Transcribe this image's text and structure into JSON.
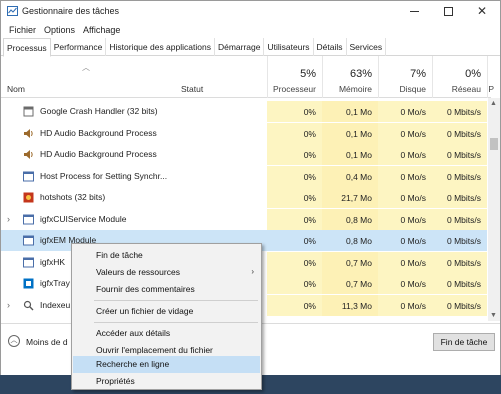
{
  "window": {
    "title": "Gestionnaire des tâches"
  },
  "menubar": [
    "Fichier",
    "Options",
    "Affichage"
  ],
  "tabs": [
    "Processus",
    "Performance",
    "Historique des applications",
    "Démarrage",
    "Utilisateurs",
    "Détails",
    "Services"
  ],
  "header": {
    "name": "Nom",
    "status": "Statut",
    "cpu": {
      "pct": "5%",
      "label": "Processeur"
    },
    "memory": {
      "pct": "63%",
      "label": "Mémoire"
    },
    "disk": {
      "pct": "7%",
      "label": "Disque"
    },
    "network": {
      "pct": "0%",
      "label": "Réseau"
    },
    "extra": {
      "label": "P"
    }
  },
  "rows": [
    {
      "name": "Google Crash Handler (32 bits)",
      "cpu": "0%",
      "mem": "0,1 Mo",
      "disk": "0 Mo/s",
      "net": "0 Mbits/s",
      "icon": "generic-app-icon"
    },
    {
      "name": "HD Audio Background Process",
      "cpu": "0%",
      "mem": "0,1 Mo",
      "disk": "0 Mo/s",
      "net": "0 Mbits/s",
      "icon": "speaker-icon"
    },
    {
      "name": "HD Audio Background Process",
      "cpu": "0%",
      "mem": "0,1 Mo",
      "disk": "0 Mo/s",
      "net": "0 Mbits/s",
      "icon": "speaker-icon"
    },
    {
      "name": "Host Process for Setting Synchr...",
      "cpu": "0%",
      "mem": "0,4 Mo",
      "disk": "0 Mo/s",
      "net": "0 Mbits/s",
      "icon": "window-app-icon"
    },
    {
      "name": "hotshots (32 bits)",
      "cpu": "0%",
      "mem": "21,7 Mo",
      "disk": "0 Mo/s",
      "net": "0 Mbits/s",
      "icon": "hotshots-icon"
    },
    {
      "name": "igfxCUIService Module",
      "cpu": "0%",
      "mem": "0,8 Mo",
      "disk": "0 Mo/s",
      "net": "0 Mbits/s",
      "icon": "window-app-icon",
      "expandable": true
    },
    {
      "name": "igfxEM Module",
      "cpu": "0%",
      "mem": "0,8 Mo",
      "disk": "0 Mo/s",
      "net": "0 Mbits/s",
      "icon": "window-app-icon",
      "selected": true
    },
    {
      "name": "igfxHK",
      "cpu": "0%",
      "mem": "0,7 Mo",
      "disk": "0 Mo/s",
      "net": "0 Mbits/s",
      "icon": "window-app-icon"
    },
    {
      "name": "igfxTray",
      "cpu": "0%",
      "mem": "0,7 Mo",
      "disk": "0 Mo/s",
      "net": "0 Mbits/s",
      "icon": "intel-tray-icon"
    },
    {
      "name": "Indexeu",
      "cpu": "0%",
      "mem": "11,3 Mo",
      "disk": "0 Mo/s",
      "net": "0 Mbits/s",
      "icon": "indexer-icon",
      "expandable": true
    }
  ],
  "footer": {
    "less_details": "Moins de d",
    "end_task": "Fin de tâche"
  },
  "context_menu": {
    "items": [
      "Fin de tâche",
      "Valeurs de ressources",
      "Fournir des commentaires",
      "Créer un fichier de vidage",
      "Accéder aux détails",
      "Ouvrir l'emplacement du fichier",
      "Recherche en ligne",
      "Propriétés"
    ],
    "submenu_arrow": "›",
    "hover_item": "Recherche en ligne"
  },
  "colors": {
    "highlight": "#fdf5c2",
    "selected_row": "#cce4f7",
    "menu_hover": "#c5dff5"
  }
}
